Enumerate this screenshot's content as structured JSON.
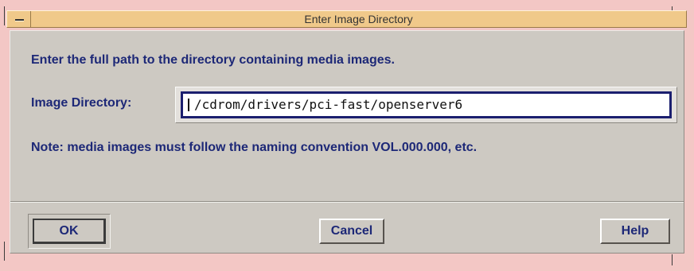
{
  "window": {
    "title": "Enter Image Directory"
  },
  "dialog": {
    "instruction": "Enter the full path to the directory containing media images.",
    "directory_label": "Image Directory:",
    "directory_value": "/cdrom/drivers/pci-fast/openserver6",
    "note": "Note: media images must follow the naming convention VOL.000.000, etc."
  },
  "buttons": {
    "ok_label": "OK",
    "cancel_label": "Cancel",
    "help_label": "Help"
  },
  "icons": {
    "window_menu": "window-menu-icon"
  },
  "colors": {
    "titlebar": "#f0c98a",
    "frame": "#f3c7c5",
    "client": "#cdc9c2",
    "text": "#1d2877",
    "input_border": "#1b1f6f"
  }
}
